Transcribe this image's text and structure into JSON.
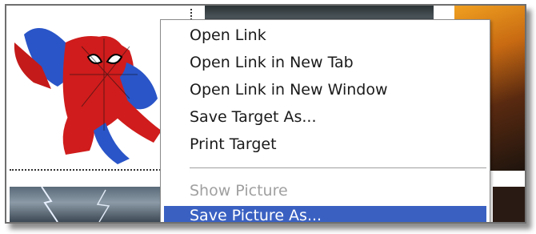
{
  "context_menu": {
    "items": [
      {
        "label": "Open Link",
        "enabled": true
      },
      {
        "label": "Open Link in New Tab",
        "enabled": true
      },
      {
        "label": "Open Link in New Window",
        "enabled": true
      },
      {
        "label": "Save Target As...",
        "enabled": true
      },
      {
        "label": "Print Target",
        "enabled": true
      },
      {
        "label": "Show Picture",
        "enabled": false
      },
      {
        "label": "Save Picture As...",
        "enabled": true,
        "highlighted": true
      }
    ]
  },
  "colors": {
    "highlight": "#3a61c2",
    "disabled_text": "#a0a0a0",
    "menu_background": "#ffffff"
  },
  "background_images": [
    {
      "icon": "spiderman-image"
    },
    {
      "icon": "dark-thumbnail-image"
    },
    {
      "icon": "orange-poster-image"
    },
    {
      "icon": "storm-thumbnail-image"
    },
    {
      "icon": "brown-thumbnail-image"
    }
  ]
}
